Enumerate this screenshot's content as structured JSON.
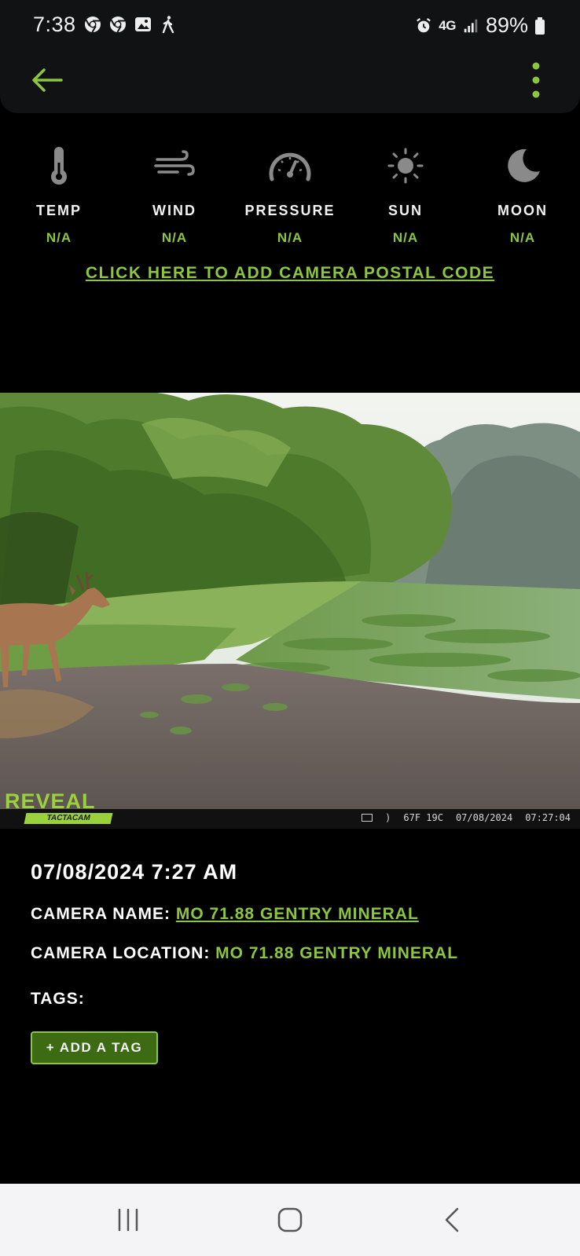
{
  "status_bar": {
    "time": "7:38",
    "network": "4G",
    "battery": "89%",
    "left_icons": [
      "chrome-icon",
      "chrome-icon",
      "gallery-icon",
      "walking-icon"
    ],
    "right_icons": [
      "alarm-icon",
      "signal-icon",
      "battery-icon"
    ]
  },
  "header": {
    "back_icon": "arrow-left-icon",
    "menu_icon": "more-vertical-icon"
  },
  "weather": [
    {
      "label": "TEMP",
      "value": "N/A",
      "icon": "thermometer-icon"
    },
    {
      "label": "WIND",
      "value": "N/A",
      "icon": "wind-icon"
    },
    {
      "label": "PRESSURE",
      "value": "N/A",
      "icon": "gauge-icon"
    },
    {
      "label": "SUN",
      "value": "N/A",
      "icon": "sun-icon"
    },
    {
      "label": "MOON",
      "value": "N/A",
      "icon": "moon-icon"
    }
  ],
  "postal_code_link": "CLICK HERE TO ADD CAMERA POSTAL CODE",
  "photo": {
    "logo_text": "REVEAL",
    "logo_sub": "TACTACAM",
    "stamp_temp": "67F 19C",
    "stamp_date": "07/08/2024",
    "stamp_time": "07:27:04"
  },
  "details": {
    "datetime": "07/08/2024 7:27 AM",
    "camera_name_label": "CAMERA NAME:",
    "camera_name": "MO 71.88 GENTRY MINERAL",
    "camera_location_label": "CAMERA LOCATION:",
    "camera_location": "MO 71.88 GENTRY MINERAL",
    "tags_label": "TAGS:"
  },
  "add_tag_button": "+ ADD A TAG",
  "colors": {
    "accent": "#8cc63f",
    "background": "#000000",
    "header": "#111214",
    "button_fill": "#3d6b14"
  }
}
